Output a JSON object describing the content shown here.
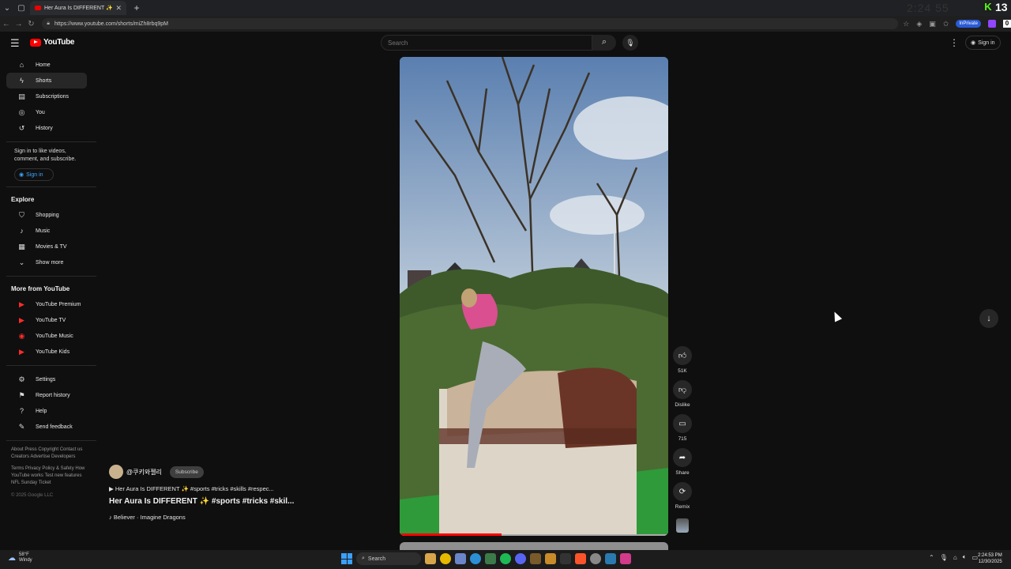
{
  "browser": {
    "tab_title": "Her Aura Is DIFFERENT ✨ #s",
    "url": "https://www.youtube.com/shorts/miZh8rbq9pM",
    "inprivate_label": "InPrivate",
    "overlay_count": "13",
    "overlay_k": "K",
    "overlay_box": "0",
    "ghost_clock": "2:24 55"
  },
  "header": {
    "logo_text": "YouTube",
    "search_placeholder": "Search",
    "signin_label": "Sign in"
  },
  "sidebar": {
    "main": [
      {
        "label": "Home",
        "icon": "home-icon"
      },
      {
        "label": "Shorts",
        "icon": "shorts-icon"
      },
      {
        "label": "Subscriptions",
        "icon": "subscriptions-icon"
      },
      {
        "label": "You",
        "icon": "you-icon"
      },
      {
        "label": "History",
        "icon": "history-icon"
      }
    ],
    "signin_prompt": "Sign in to like videos, comment, and subscribe.",
    "signin_button": "Sign in",
    "explore_heading": "Explore",
    "explore": [
      {
        "label": "Shopping",
        "icon": "shopping-icon"
      },
      {
        "label": "Music",
        "icon": "music-icon"
      },
      {
        "label": "Movies & TV",
        "icon": "movies-icon"
      },
      {
        "label": "Show more",
        "icon": "chevron-down-icon"
      }
    ],
    "more_heading": "More from YouTube",
    "more": [
      {
        "label": "YouTube Premium"
      },
      {
        "label": "YouTube TV"
      },
      {
        "label": "YouTube Music"
      },
      {
        "label": "YouTube Kids"
      }
    ],
    "settings": [
      {
        "label": "Settings",
        "icon": "gear-icon"
      },
      {
        "label": "Report history",
        "icon": "flag-icon"
      },
      {
        "label": "Help",
        "icon": "help-icon"
      },
      {
        "label": "Send feedback",
        "icon": "feedback-icon"
      }
    ],
    "footer_1": "About  Press  Copyright  Contact us  Creators  Advertise  Developers",
    "footer_2": "Terms  Privacy  Policy & Safety  How YouTube works  Test new features  NFL Sunday Ticket",
    "copyright": "© 2025 Google LLC"
  },
  "short": {
    "channel": "@쿠키와젤리",
    "subscribe_label": "Subscribe",
    "tags_line": "▶ Her Aura Is DIFFERENT ✨ #sports #tricks #skills #respec...",
    "title": "Her Aura Is DIFFERENT ✨ #sports #tricks #skil...",
    "music": "♪ Believer · Imagine Dragons",
    "likes": "51K",
    "dislike_label": "Dislike",
    "comments": "715",
    "share_label": "Share",
    "remix_label": "Remix",
    "progress_fraction": 0.38
  },
  "taskbar": {
    "temp": "58°F",
    "condition": "Windy",
    "search_label": "Search",
    "time": "2:24:53 PM",
    "date": "12/30/2025"
  }
}
